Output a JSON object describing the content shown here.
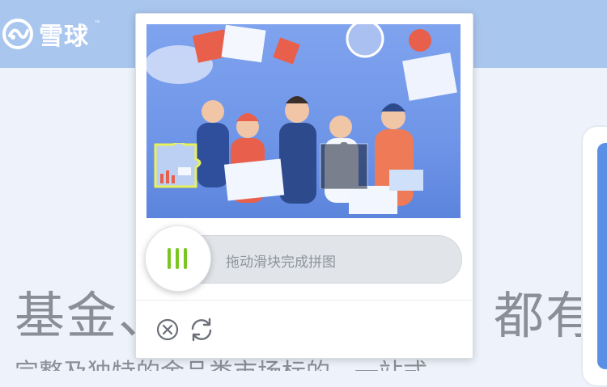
{
  "site": {
    "logo_text": "雪球",
    "logo_tm": "™",
    "hero_title_left": "基金、",
    "hero_title_right": "都有",
    "hero_subtitle": "完整及独特的金品类市场标的，一站式"
  },
  "captcha": {
    "slider_hint": "拖动滑块完成拼图",
    "accent_color": "#7bc61e",
    "close_icon": "close-circle-icon",
    "refresh_icon": "refresh-icon"
  }
}
